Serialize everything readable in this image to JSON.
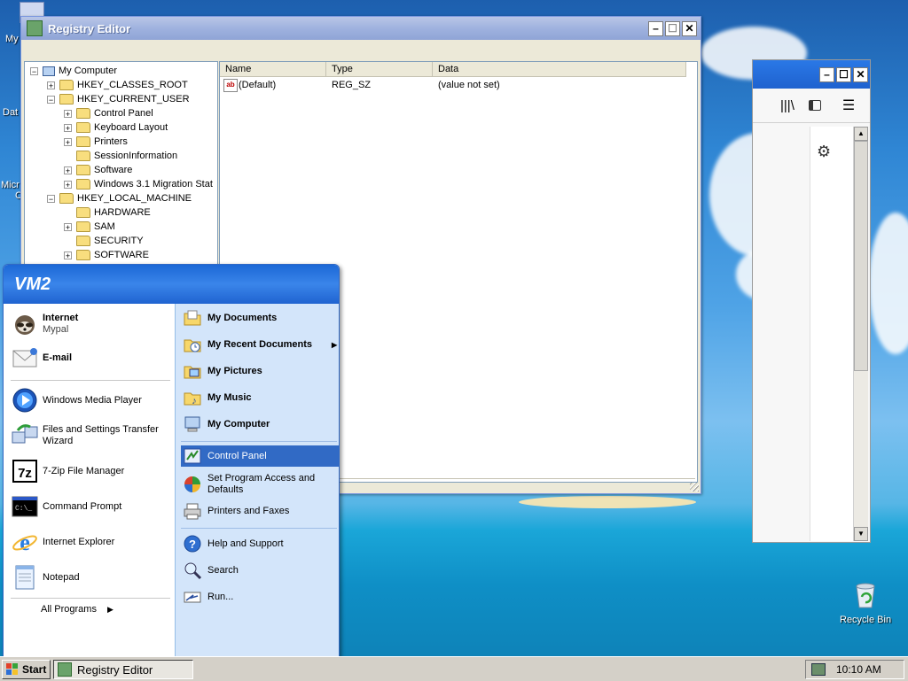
{
  "desktop": {
    "icons": [
      {
        "label": "My"
      },
      {
        "label": "Dat"
      },
      {
        "label": "Micr"
      },
      {
        "label": "C"
      },
      {
        "label": "Recycle Bin"
      }
    ]
  },
  "regedit": {
    "title": "Registry Editor",
    "tree": [
      {
        "label": "My Computer",
        "level": 0,
        "exp": "−"
      },
      {
        "label": "HKEY_CLASSES_ROOT",
        "level": 1,
        "exp": "+"
      },
      {
        "label": "HKEY_CURRENT_USER",
        "level": 1,
        "exp": "−"
      },
      {
        "label": "Control Panel",
        "level": 2,
        "exp": "+"
      },
      {
        "label": "Keyboard Layout",
        "level": 2,
        "exp": "+"
      },
      {
        "label": "Printers",
        "level": 2,
        "exp": "+"
      },
      {
        "label": "SessionInformation",
        "level": 2,
        "exp": ""
      },
      {
        "label": "Software",
        "level": 2,
        "exp": "+"
      },
      {
        "label": "Windows 3.1 Migration Stat",
        "level": 2,
        "exp": "+"
      },
      {
        "label": "HKEY_LOCAL_MACHINE",
        "level": 1,
        "exp": "−"
      },
      {
        "label": "HARDWARE",
        "level": 2,
        "exp": ""
      },
      {
        "label": "SAM",
        "level": 2,
        "exp": "+"
      },
      {
        "label": "SECURITY",
        "level": 2,
        "exp": ""
      },
      {
        "label": "SOFTWARE",
        "level": 2,
        "exp": "+"
      }
    ],
    "columns": [
      "Name",
      "Type",
      "Data"
    ],
    "rows": [
      {
        "name": "(Default)",
        "type": "REG_SZ",
        "data": "(value not set)"
      }
    ]
  },
  "startmenu": {
    "user": "VM2",
    "pinned": [
      {
        "title": "Internet",
        "sub": "Mypal",
        "icon": "mypal-icon"
      },
      {
        "title": "E-mail",
        "sub": "",
        "icon": "email-icon"
      }
    ],
    "recent": [
      {
        "label": "Windows Media Player",
        "icon": "media-player-icon"
      },
      {
        "label": "Files and Settings Transfer Wizard",
        "icon": "transfer-wizard-icon"
      },
      {
        "label": "7-Zip File Manager",
        "icon": "7zip-icon"
      },
      {
        "label": "Command Prompt",
        "icon": "command-prompt-icon"
      },
      {
        "label": "Internet Explorer",
        "icon": "ie-icon"
      },
      {
        "label": "Notepad",
        "icon": "notepad-icon"
      }
    ],
    "all_programs": "All Programs",
    "right_top": [
      {
        "label": "My Documents",
        "icon": "my-documents-icon"
      },
      {
        "label": "My Recent Documents",
        "icon": "recent-documents-icon"
      },
      {
        "label": "My Pictures",
        "icon": "my-pictures-icon"
      },
      {
        "label": "My Music",
        "icon": "my-music-icon"
      },
      {
        "label": "My Computer",
        "icon": "my-computer-icon"
      }
    ],
    "right_mid": [
      {
        "label": "Control Panel",
        "icon": "control-panel-icon"
      },
      {
        "label": "Set Program Access and Defaults",
        "icon": "program-access-icon"
      },
      {
        "label": "Printers and Faxes",
        "icon": "printer-icon"
      }
    ],
    "right_bottom": [
      {
        "label": "Help and Support",
        "icon": "help-icon"
      },
      {
        "label": "Search",
        "icon": "search-icon"
      },
      {
        "label": "Run...",
        "icon": "run-icon"
      }
    ]
  },
  "taskbar": {
    "start": "Start",
    "task": "Registry Editor",
    "clock": "10:10 AM"
  },
  "colors": {
    "start_header": "#2a74de",
    "selection": "#316ac5",
    "taskbar": "#d4d0c8"
  }
}
